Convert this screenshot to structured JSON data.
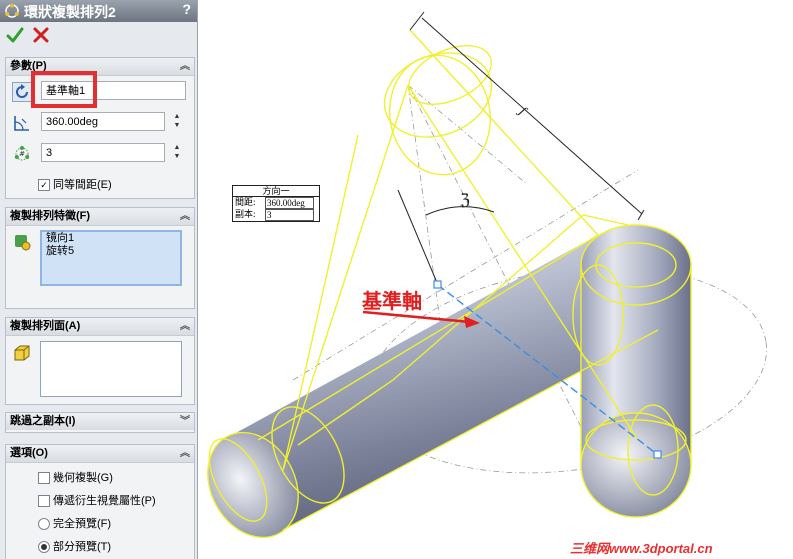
{
  "title": "環狀複製排列2",
  "help_glyph": "?",
  "groups": {
    "params": {
      "header": "參數(P)",
      "axis_value": "基準軸1",
      "angle_value": "360.00deg",
      "count_value": "3",
      "equal_spacing_label": "同等間距(E)",
      "equal_spacing_checked": true
    },
    "features": {
      "header": "複製排列特徵(F)",
      "items": [
        "镜向1",
        "旋转5"
      ]
    },
    "faces": {
      "header": "複製排列面(A)"
    },
    "skip": {
      "header": "跳過之副本(I)"
    },
    "options": {
      "header": "選項(O)",
      "geometry_pattern_label": "幾何複製(G)",
      "propagate_label": "傳遞衍生視覺屬性(P)",
      "full_preview_label": "完全預覽(F)",
      "partial_preview_label": "部分預覽(T)",
      "selected_preview": "partial"
    }
  },
  "viewport": {
    "callout_title": "方向一",
    "callout_spacing_label": "間距:",
    "callout_spacing_value": "360.00deg",
    "callout_copies_label": "副本:",
    "callout_copies_value": "3",
    "axis_annotation": "基準軸",
    "watermark": "三维网www.3dportal.cn"
  },
  "icons": {
    "title": "circular-pattern-icon",
    "ok": "green-check-icon",
    "cancel": "red-x-icon",
    "axis": "rotate-arrow-icon",
    "angle": "angle-icon",
    "count": "instances-icon",
    "features": "features-icon",
    "faces": "face-cube-icon"
  },
  "colors": {
    "highlight": "#e23030",
    "preview_yellow": "#f0f030",
    "axis_dash": "#3a8ee6",
    "ok_green": "#2ea02e",
    "cancel_red": "#d02020"
  }
}
